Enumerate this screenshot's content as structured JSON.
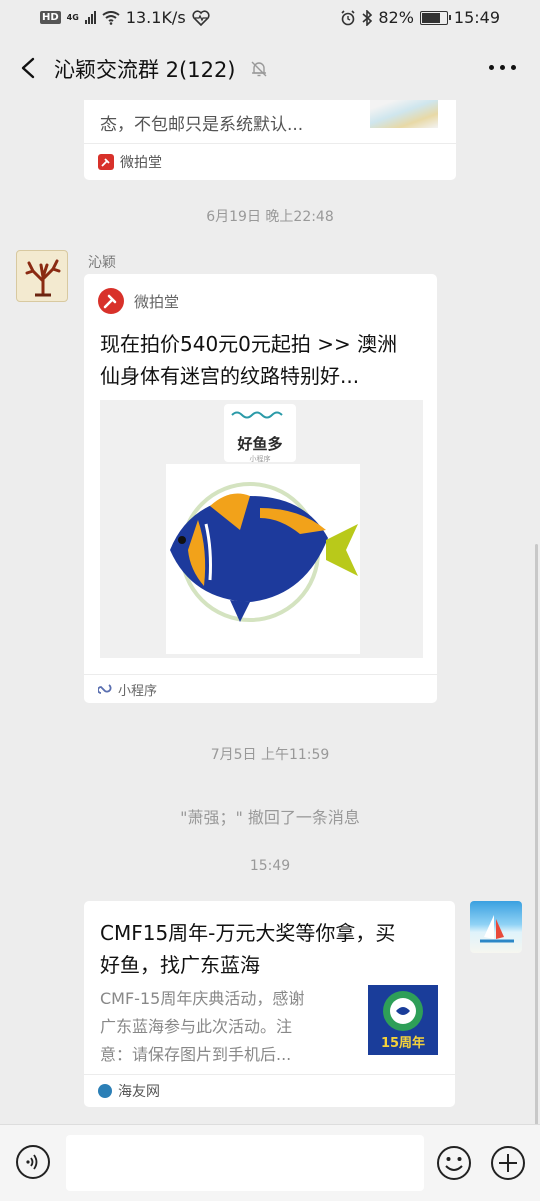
{
  "status_bar": {
    "hd": "HD",
    "network": "4G",
    "speed": "13.1K/s",
    "battery": "82%",
    "battery_level": 0.82,
    "time": "15:49"
  },
  "nav": {
    "title": "沁颖交流群 2(122)"
  },
  "chat": {
    "top_card": {
      "text": "态，不包邮只是系统默认...",
      "source": "微拍堂"
    },
    "timestamp_1": "6月19日 晚上22:48",
    "message_1": {
      "sender": "沁颖",
      "app_name": "微拍堂",
      "title_line1": "现在拍价540元0元起拍 >> 澳洲",
      "title_line2": "仙身体有迷宫的纹路特别好...",
      "image_logo_text": "好鱼多",
      "image_logo_sub": "小程序",
      "footer": "小程序"
    },
    "timestamp_2": "7月5日 上午11:59",
    "recall_notice": "\"萧强；\" 撤回了一条消息",
    "timestamp_3": "15:49",
    "message_2": {
      "title_line1": "CMF15周年-万元大奖等你拿，买",
      "title_line2": "好鱼，找广东蓝海",
      "desc_line1": "CMF-15周年庆典活动，感谢",
      "desc_line2": "广东蓝海参与此次活动。注",
      "desc_line3": "意：请保存图片到手机后...",
      "thumb_text": "15周年",
      "source": "海友网"
    }
  },
  "input_bar": {
    "placeholder": ""
  },
  "colors": {
    "background": "#ededed",
    "weipaitang_red": "#d8312a",
    "timestamp_gray": "#999999"
  }
}
